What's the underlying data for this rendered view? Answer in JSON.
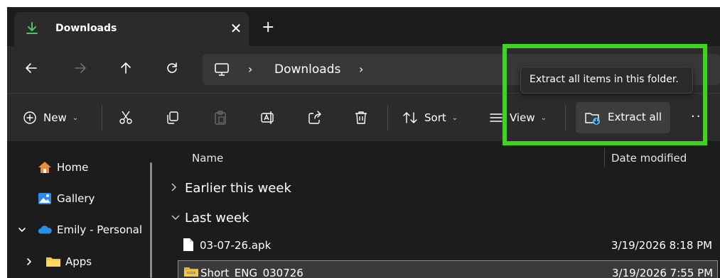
{
  "tab": {
    "title": "Downloads",
    "icon": "download-icon",
    "close_glyph": "✕",
    "new_tab_glyph": "+"
  },
  "address": {
    "root_icon": "pc-icon",
    "separator": "›",
    "path": "Downloads"
  },
  "toolbar": {
    "new_label": "New",
    "sort_label": "Sort",
    "view_label": "View",
    "extract_all_label": "Extract all",
    "more_glyph": "···",
    "chevron": "⌄"
  },
  "tooltip": {
    "text": "Extract all items in this folder."
  },
  "sidebar": {
    "items": [
      {
        "label": "Home",
        "icon": "home-icon"
      },
      {
        "label": "Gallery",
        "icon": "gallery-icon"
      },
      {
        "label": "Emily - Personal",
        "icon": "onedrive-icon",
        "expanded": true
      },
      {
        "label": "Apps",
        "icon": "folder-icon",
        "expanded": false
      }
    ]
  },
  "columns": {
    "name": "Name",
    "date_modified": "Date modified"
  },
  "groups": [
    {
      "label": "Earlier this week",
      "expanded": false
    },
    {
      "label": "Last week",
      "expanded": true
    }
  ],
  "files": [
    {
      "name": "03-07-26.apk",
      "date": "3/19/2026 8:18 PM",
      "type": "file",
      "selected": false
    },
    {
      "name": "Short_ENG_030726",
      "date": "3/19/2026 7:55 PM",
      "type": "zip",
      "selected": true
    }
  ],
  "colors": {
    "background": "#1c1c1c",
    "panel": "#2b2b2b",
    "highlight": "#3ed31d",
    "accent_blue": "#4cc2ff",
    "folder_yellow": "#f5c843"
  }
}
